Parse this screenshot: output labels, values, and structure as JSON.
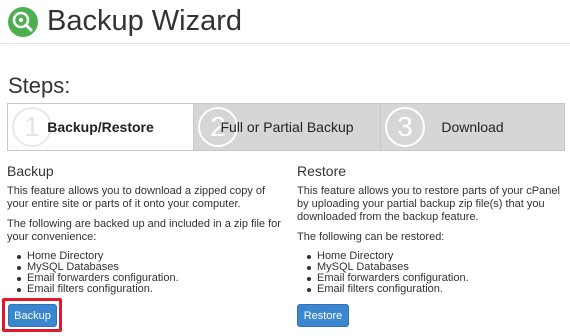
{
  "header": {
    "title": "Backup Wizard",
    "icon": "backup-wizard-icon"
  },
  "steps": {
    "heading": "Steps:",
    "items": [
      {
        "number": "1",
        "label": "Backup/Restore",
        "active": true
      },
      {
        "number": "2",
        "label": "Full or Partial Backup",
        "active": false
      },
      {
        "number": "3",
        "label": "Download",
        "active": false
      }
    ]
  },
  "backup": {
    "title": "Backup",
    "description": "This feature allows you to download a zipped copy of your entire site or parts of it onto your computer.",
    "intro": "The following are backed up and included in a zip file for your convenience:",
    "items": [
      "Home Directory",
      "MySQL Databases",
      "Email forwarders configuration.",
      "Email filters configuration."
    ],
    "button_label": "Backup"
  },
  "restore": {
    "title": "Restore",
    "description": "This feature allows you to restore parts of your cPanel by uploading your partial backup zip file(s) that you downloaded from the backup feature.",
    "intro": "The following can be restored:",
    "items": [
      "Home Directory",
      "MySQL Databases",
      "Email forwarders configuration.",
      "Email filters configuration."
    ],
    "button_label": "Restore"
  },
  "colors": {
    "button": "#3a87d0",
    "highlight": "#e0192b",
    "icon_green": "#4caf50"
  }
}
